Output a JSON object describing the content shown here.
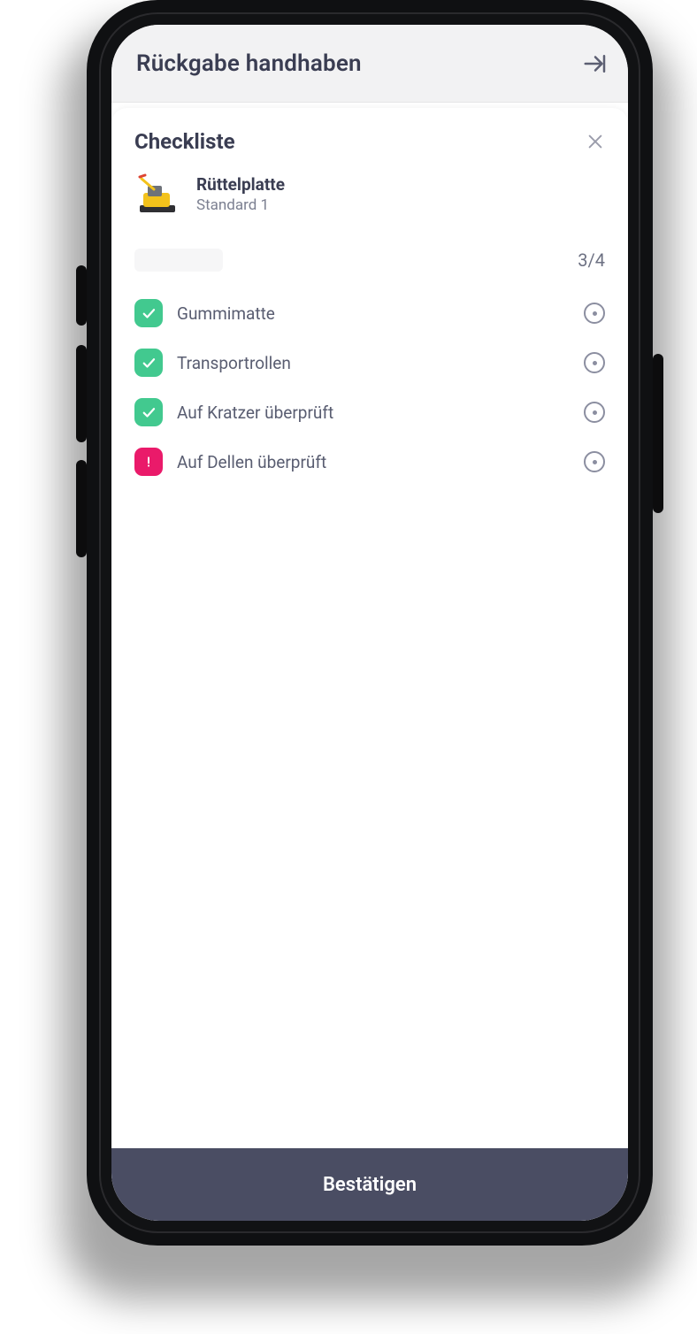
{
  "appbar": {
    "title": "Rückgabe handhaben"
  },
  "sheet": {
    "title": "Checkliste",
    "product": {
      "name": "Rüttelplatte",
      "subtitle": "Standard 1"
    },
    "progress": "3/4",
    "items": [
      {
        "label": "Gummimatte",
        "status": "ok"
      },
      {
        "label": "Transportrollen",
        "status": "ok"
      },
      {
        "label": "Auf Kratzer überprüft",
        "status": "ok"
      },
      {
        "label": "Auf Dellen überprüft",
        "status": "warn"
      }
    ]
  },
  "confirm_label": "Bestätigen",
  "colors": {
    "ok": "#42c98f",
    "warn": "#ea1a6a",
    "bar": "#4a4d63"
  }
}
